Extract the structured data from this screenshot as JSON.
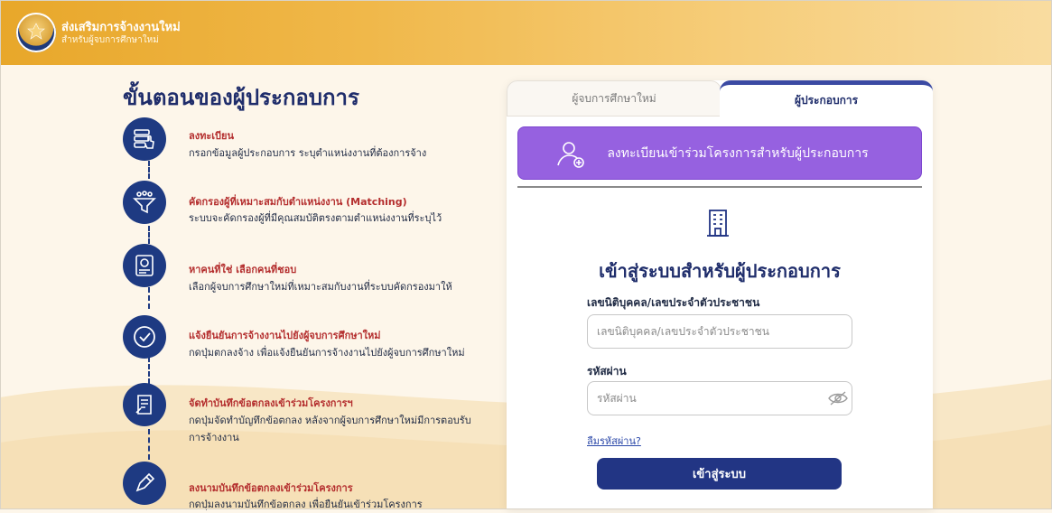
{
  "header": {
    "brand_title": "ส่งเสริมการจ้างงานใหม่",
    "brand_subtitle": "สำหรับผู้จบการศึกษาใหม่",
    "logo_icon": "government-seal-icon"
  },
  "steps": {
    "title": "ขั้นตอนของผู้ประกอบการ",
    "items": [
      {
        "title": "ลงทะเบียน",
        "desc": "กรอกข้อมูลผู้ประกอบการ ระบุตำแหน่งงานที่ต้องการจ้าง",
        "icon": "register-hand-icon"
      },
      {
        "title": "คัดกรองผู้ที่เหมาะสมกับตำแหน่งงาน (Matching)",
        "desc": "ระบบจะคัดกรองผู้ที่มีคุณสมบัติตรงตามตำแหน่งงานที่ระบุไว้",
        "icon": "filter-funnel-icon"
      },
      {
        "title": "หาคนที่ใช่ เลือกคนที่ชอบ",
        "desc": "เลือกผู้จบการศึกษาใหม่ที่เหมาะสมกับงานที่ระบบคัดกรองมาให้",
        "icon": "profile-search-icon"
      },
      {
        "title": "แจ้งยืนยันการจ้างงานไปยังผู้จบการศึกษาใหม่",
        "desc": "กดปุ่มตกลงจ้าง เพื่อแจ้งยืนยันการจ้างงานไปยังผู้จบการศึกษาใหม่",
        "icon": "check-circle-icon"
      },
      {
        "title": "จัดทำบันทึกข้อตกลงเข้าร่วมโครงการฯ",
        "desc": "กดปุ่มจัดทำบัญทึกข้อตกลง หลังจากผู้จบการศึกษาใหม่มีการตอบรับการจ้างงาน",
        "icon": "document-scroll-icon"
      },
      {
        "title": "ลงนามบันทึกข้อตกลงเข้าร่วมโครงการ",
        "desc": "กดปุ่มลงนามบันทึกข้อตกลง เพื่อยืนยันเข้าร่วมโครงการ",
        "icon": "pen-sign-icon"
      }
    ]
  },
  "tabs": {
    "graduate": "ผู้จบการศึกษาใหม่",
    "employer": "ผู้ประกอบการ"
  },
  "register": {
    "label": "ลงทะเบียนเข้าร่วมโครงการสำหรับผู้ประกอบการ",
    "icon": "add-user-icon"
  },
  "login": {
    "icon": "building-icon",
    "title": "เข้าสู่ระบบสำหรับผู้ประกอบการ",
    "id_label": "เลขนิติบุคคล/เลขประจำตัวประชาชน",
    "id_placeholder": "เลขนิติบุคคล/เลขประจำตัวประชาชน",
    "id_value": "",
    "password_label": "รหัสผ่าน",
    "password_placeholder": "รหัสผ่าน",
    "password_value": "",
    "eye_icon": "eye-off-icon",
    "forgot_label": "ลืมรหัสผ่าน?",
    "submit_label": "เข้าสู่ระบบ"
  },
  "colors": {
    "header_gradient_start": "#e8a72a",
    "navy": "#1e3a82",
    "purple": "#9661e0",
    "step_title_red": "#b42e2e"
  }
}
